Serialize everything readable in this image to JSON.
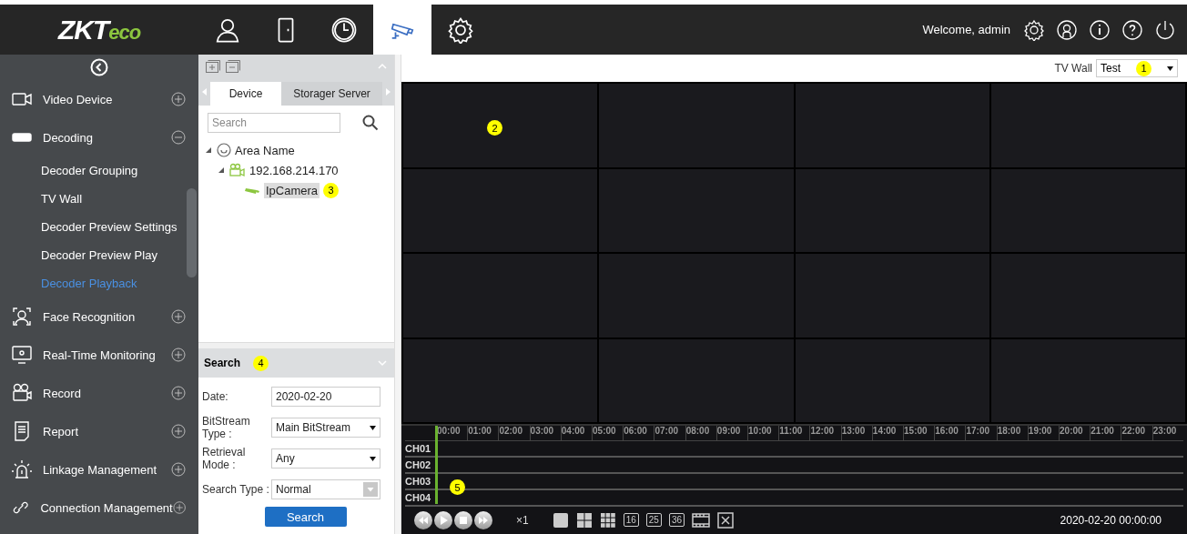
{
  "logo": {
    "main": "ZKT",
    "accent": "eco"
  },
  "nav_tabs": [
    {
      "selected": false
    },
    {
      "selected": false
    },
    {
      "selected": false
    },
    {
      "selected": true
    },
    {
      "selected": false
    }
  ],
  "user": {
    "welcome": "Welcome, admin"
  },
  "sidebar": {
    "items": [
      {
        "label": "Video Device",
        "expanded": false
      },
      {
        "label": "Decoding",
        "expanded": true,
        "children": [
          {
            "label": "Decoder Grouping",
            "selected": false
          },
          {
            "label": "TV Wall",
            "selected": false
          },
          {
            "label": "Decoder Preview Settings",
            "selected": false
          },
          {
            "label": "Decoder Preview Play",
            "selected": false
          },
          {
            "label": "Decoder Playback",
            "selected": true
          }
        ]
      },
      {
        "label": "Face Recognition",
        "expanded": false
      },
      {
        "label": "Real-Time Monitoring",
        "expanded": false
      },
      {
        "label": "Record",
        "expanded": false
      },
      {
        "label": "Report",
        "expanded": false
      },
      {
        "label": "Linkage Management",
        "expanded": false
      },
      {
        "label": "Connection Management",
        "expanded": false
      }
    ]
  },
  "device_panel": {
    "tabs": [
      {
        "label": "Device",
        "selected": true
      },
      {
        "label": "Storager Server",
        "selected": false
      }
    ],
    "search": {
      "placeholder": "Search"
    },
    "tree": [
      {
        "label": "Area Name",
        "expanded": true,
        "children": [
          {
            "label": "192.168.214.170",
            "expanded": true,
            "children": [
              {
                "label": "IpCamera",
                "selected": true,
                "callout": "3"
              }
            ]
          }
        ]
      }
    ]
  },
  "search_panel": {
    "title": "Search",
    "callout": "4",
    "fields": [
      {
        "label": "Date:",
        "value": "2020-02-20",
        "kind": "text"
      },
      {
        "label": "BitStream Type :",
        "value": "Main BitStream",
        "kind": "select"
      },
      {
        "label": "Retrieval Mode :",
        "value": "Any",
        "kind": "select"
      },
      {
        "label": "Search Type :",
        "value": "Normal",
        "kind": "disabled-select"
      }
    ],
    "button": "Search"
  },
  "tv_wall": {
    "label": "TV Wall",
    "value": "Test",
    "callout": "1"
  },
  "video_grid": {
    "callout": "2"
  },
  "timeline": {
    "hours": [
      "00:00",
      "01:00",
      "02:00",
      "03:00",
      "04:00",
      "05:00",
      "06:00",
      "07:00",
      "08:00",
      "09:00",
      "10:00",
      "11:00",
      "12:00",
      "13:00",
      "14:00",
      "15:00",
      "16:00",
      "17:00",
      "18:00",
      "19:00",
      "20:00",
      "21:00",
      "22:00",
      "23:00"
    ],
    "channels": [
      "CH01",
      "CH02",
      "CH03",
      "CH04"
    ],
    "callout": "5"
  },
  "playback": {
    "speed": "×1",
    "layouts": [
      {
        "kind": "single"
      },
      {
        "kind": "quad"
      },
      {
        "kind": "nine"
      },
      {
        "kind": "number",
        "label": "16"
      },
      {
        "kind": "number",
        "label": "25"
      },
      {
        "kind": "number",
        "label": "36"
      },
      {
        "kind": "film"
      },
      {
        "kind": "close"
      }
    ],
    "time": "2020-02-20 00:00:00"
  }
}
